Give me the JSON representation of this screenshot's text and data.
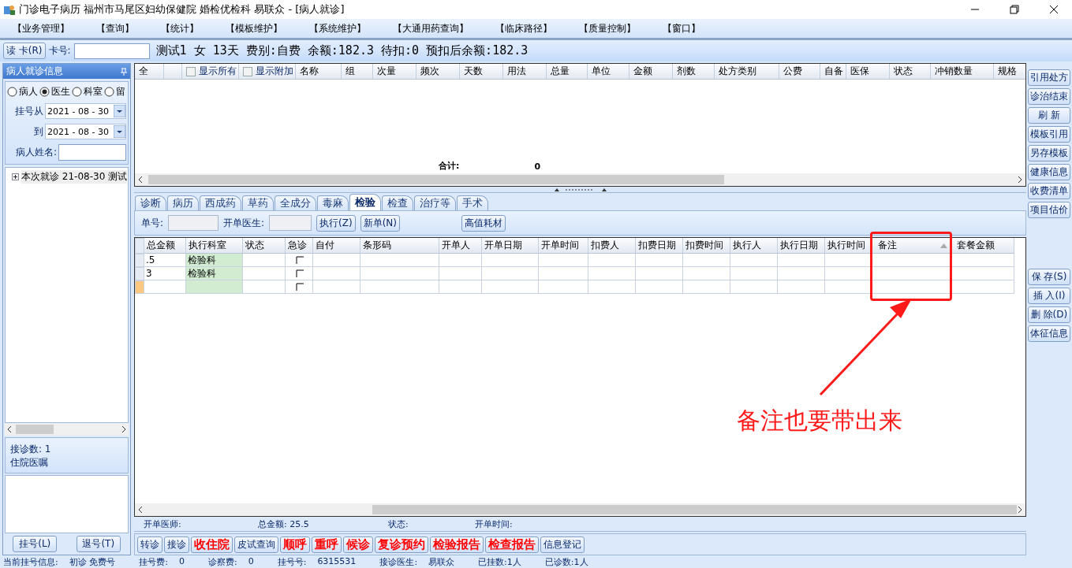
{
  "window": {
    "title": "门诊电子病历  福州市马尾区妇幼保健院  婚检优检科  易联众 - [病人就诊]"
  },
  "menu": [
    "【业务管理】",
    "【查询】",
    "【统计】",
    "【模板维护】",
    "【系统维护】",
    "【大通用药查询】",
    "【临床路径】",
    "【质量控制】",
    "【窗口】"
  ],
  "toolbar": {
    "read_card_button": "读 卡(R)",
    "card_label": "卡号:",
    "patient_info": "测试1 女 13天 费别:自费 余额:182.3 待扣:0 预扣后余额:182.3"
  },
  "left_panel": {
    "title": "病人就诊信息",
    "filters": [
      {
        "label": "病人",
        "selected": false
      },
      {
        "label": "医生",
        "selected": true
      },
      {
        "label": "科室",
        "selected": false
      },
      {
        "label": "留",
        "selected": false
      }
    ],
    "date_from_label": "挂号从",
    "date_from": "2021 - 08 - 30",
    "date_to_label": "到",
    "date_to": "2021 - 08 - 30",
    "name_label": "病人姓名:",
    "tree": [
      {
        "label": "本次就诊 21-08-30 测试",
        "expanded": false
      }
    ],
    "count_text": "接诊数: 1",
    "section_title": "住院医嘱",
    "buttons": [
      "挂号(L)",
      "退号(T)"
    ]
  },
  "upper_grid": {
    "columns": [
      {
        "label": "全"
      },
      {},
      {
        "label": "显示所有",
        "kind": "checkbox",
        "checked": false
      },
      {
        "label": "显示附加",
        "kind": "checkbox",
        "checked": false
      },
      {
        "label": "名称"
      },
      {
        "label": "组"
      },
      {
        "label": "次量"
      },
      {
        "label": "频次"
      },
      {
        "label": "天数"
      },
      {
        "label": "用法"
      },
      {
        "label": "总量"
      },
      {
        "label": "单位"
      },
      {
        "label": "金额"
      },
      {
        "label": "剂数"
      },
      {
        "label": "处方类别"
      },
      {
        "label": "公费"
      },
      {
        "label": "自备"
      },
      {
        "label": "医保"
      },
      {
        "label": "状态"
      },
      {
        "label": "冲销数量"
      },
      {
        "label": "规格"
      }
    ],
    "total_label": "合计:",
    "total_value": "0"
  },
  "right_buttons": [
    "引用处方",
    "诊治结束",
    "刷 新",
    "模板引用",
    "另存模板",
    "健康信息",
    "收费清单",
    "项目估价"
  ],
  "right_buttons_lower": [
    "保 存(S)",
    "插 入(I)",
    "删 除(D)",
    "体征信息"
  ],
  "tabs": [
    {
      "label": "诊断",
      "selected": false
    },
    {
      "label": "病历",
      "selected": false
    },
    {
      "label": "西成药",
      "selected": false
    },
    {
      "label": "草药",
      "selected": false
    },
    {
      "label": "全成分",
      "selected": false
    },
    {
      "label": "毒麻",
      "selected": false
    },
    {
      "label": "检验",
      "selected": true
    },
    {
      "label": "检查",
      "selected": false
    },
    {
      "label": "治疗等",
      "selected": false
    },
    {
      "label": "手术",
      "selected": false
    }
  ],
  "order_bar": {
    "number_label": "单号:",
    "doctor_label": "开单医生:",
    "buttons": [
      "执行(Z)",
      "新单(N)",
      "高值耗材"
    ]
  },
  "lower_grid": {
    "columns": [
      {
        "label": "总金额"
      },
      {
        "label": "执行科室"
      },
      {
        "label": "状态"
      },
      {
        "label": "急诊"
      },
      {
        "label": "自付"
      },
      {
        "label": "条形码"
      },
      {
        "label": "开单人"
      },
      {
        "label": "开单日期"
      },
      {
        "label": "开单时间"
      },
      {
        "label": "扣费人"
      },
      {
        "label": "扣费日期"
      },
      {
        "label": "扣费时间"
      },
      {
        "label": "执行人"
      },
      {
        "label": "执行日期"
      },
      {
        "label": "执行时间"
      },
      {
        "label": "备注",
        "sorted": true
      },
      {
        "label": "套餐金额"
      }
    ],
    "rows": [
      {
        "total": ".5",
        "dept": "检验科",
        "urgent": false,
        "current": false
      },
      {
        "total": "3",
        "dept": "检验科",
        "urgent": false,
        "current": false
      },
      {
        "urgent": false,
        "current": true
      }
    ]
  },
  "order_info": [
    {
      "label": "开单医师:"
    },
    {
      "label": "总金额:",
      "value": "25.5"
    },
    {
      "label": "状态:"
    },
    {
      "label": "开单时间:"
    }
  ],
  "actions": [
    {
      "label": "转诊",
      "emphasis": false
    },
    {
      "label": "接诊",
      "emphasis": false
    },
    {
      "label": "收住院",
      "emphasis": true
    },
    {
      "label": "皮试查询",
      "emphasis": false
    },
    {
      "label": "顺呼",
      "emphasis": true
    },
    {
      "label": "重呼",
      "emphasis": true
    },
    {
      "label": "候诊",
      "emphasis": true
    },
    {
      "label": "复诊预约",
      "emphasis": true
    },
    {
      "label": "检验报告",
      "emphasis": true
    },
    {
      "label": "检查报告",
      "emphasis": true
    },
    {
      "label": "信息登记",
      "emphasis": false
    }
  ],
  "status_bar": [
    {
      "label": "当前挂号信息:",
      "value": "初诊 免费号"
    },
    {
      "label": "挂号费:",
      "value": "0"
    },
    {
      "label": "诊察费:",
      "value": "0"
    },
    {
      "label": "挂号号:",
      "value": "6315531"
    },
    {
      "label": "接诊医生:",
      "value": "易联众"
    },
    {
      "label": "已挂数:1人"
    },
    {
      "label": "已诊数:1人"
    }
  ],
  "annotation": {
    "text": "备注也要带出来"
  }
}
